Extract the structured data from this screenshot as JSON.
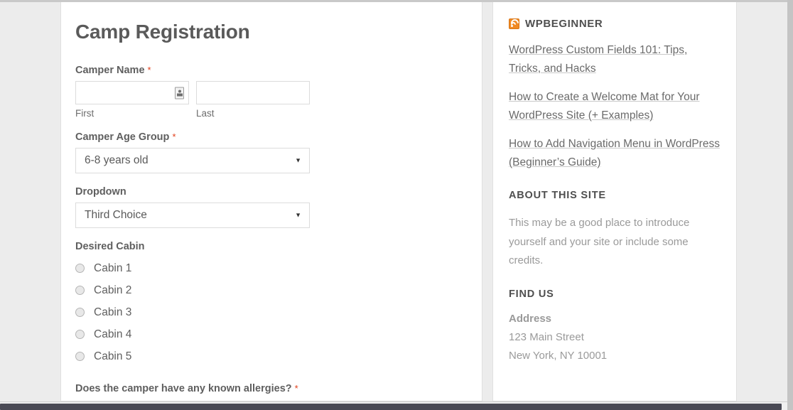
{
  "form": {
    "title": "Camp Registration",
    "camper_name": {
      "label": "Camper Name",
      "required_mark": "*",
      "first_value": "",
      "first_placeholder": "",
      "first_sublabel": "First",
      "last_value": "",
      "last_placeholder": "",
      "last_sublabel": "Last",
      "autofill_icon": "contact-card-icon"
    },
    "age_group": {
      "label": "Camper Age Group",
      "required_mark": "*",
      "selected": "6-8 years old",
      "arrow_icon": "chevron-down-icon"
    },
    "dropdown": {
      "label": "Dropdown",
      "selected": "Third Choice",
      "arrow_icon": "chevron-down-icon"
    },
    "desired_cabin": {
      "label": "Desired Cabin",
      "options": [
        "Cabin 1",
        "Cabin 2",
        "Cabin 3",
        "Cabin 4",
        "Cabin 5"
      ]
    },
    "allergies_question": {
      "label": "Does the camper have any known allergies?",
      "required_mark": "*"
    }
  },
  "sidebar": {
    "feed_widget": {
      "icon": "rss-icon",
      "title": "WPBEGINNER",
      "items": [
        "WordPress Custom Fields 101: Tips, Tricks, and Hacks",
        "How to Create a Welcome Mat for Your WordPress Site (+ Examples)",
        "How to Add Navigation Menu in WordPress (Beginner’s Guide)"
      ]
    },
    "about_widget": {
      "title": "ABOUT THIS SITE",
      "text": "This may be a good place to introduce yourself and your site or include some credits."
    },
    "find_us_widget": {
      "title": "FIND US",
      "address_label": "Address",
      "address_lines": [
        "123 Main Street",
        "New York, NY 10001"
      ]
    }
  },
  "colors": {
    "accent_orange": "#f08a24",
    "required_red": "#e2401c",
    "heading_gray": "#5a5a5a",
    "muted_gray": "#9a9a9a",
    "page_background": "#ececec"
  }
}
